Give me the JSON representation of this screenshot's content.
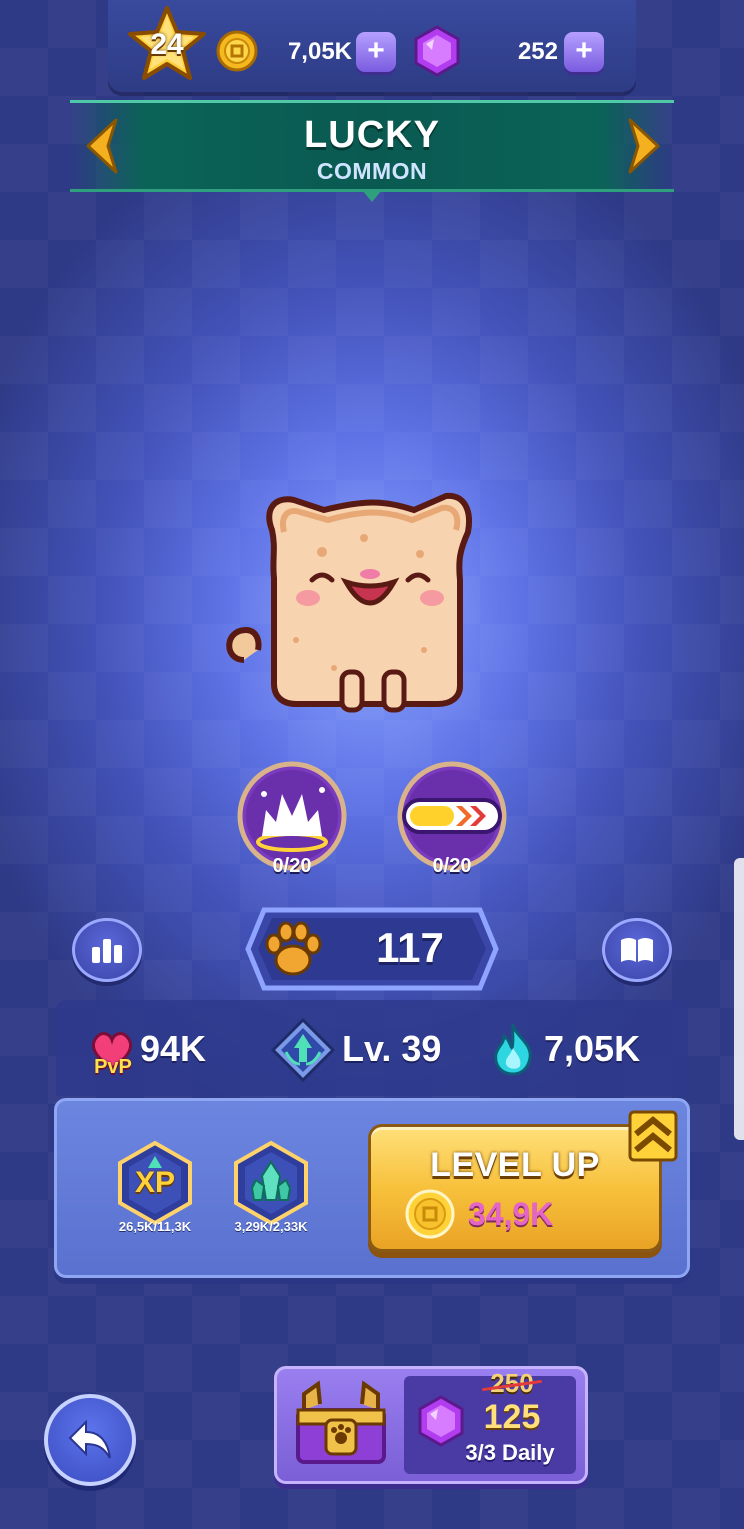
{
  "header": {
    "player_level": "24",
    "coins": "7,05K",
    "gems": "252"
  },
  "character": {
    "name": "LUCKY",
    "rarity": "COMMON"
  },
  "skills": [
    {
      "icon": "burst-skill-icon",
      "progress": "0/20"
    },
    {
      "icon": "speed-bar-skill-icon",
      "progress": "0/20"
    }
  ],
  "paw_count": "117",
  "stats": {
    "pvp_label": "PvP",
    "pvp_value": "94K",
    "level_value": "Lv. 39",
    "power_value": "7,05K"
  },
  "upgrades": {
    "xp_label": "XP",
    "xp_progress": "26,5K/11,3K",
    "crystal_progress": "3,29K/2,33K"
  },
  "level_up": {
    "label": "LEVEL UP",
    "cost": "34,9K"
  },
  "offer": {
    "old_price": "250",
    "new_price": "125",
    "daily": "3/3 Daily"
  },
  "colors": {
    "accent_gold": "#f7c13c",
    "banner_green": "#0a5a52",
    "cost_pink": "#e565c6",
    "background_blue": "#4252b8"
  }
}
